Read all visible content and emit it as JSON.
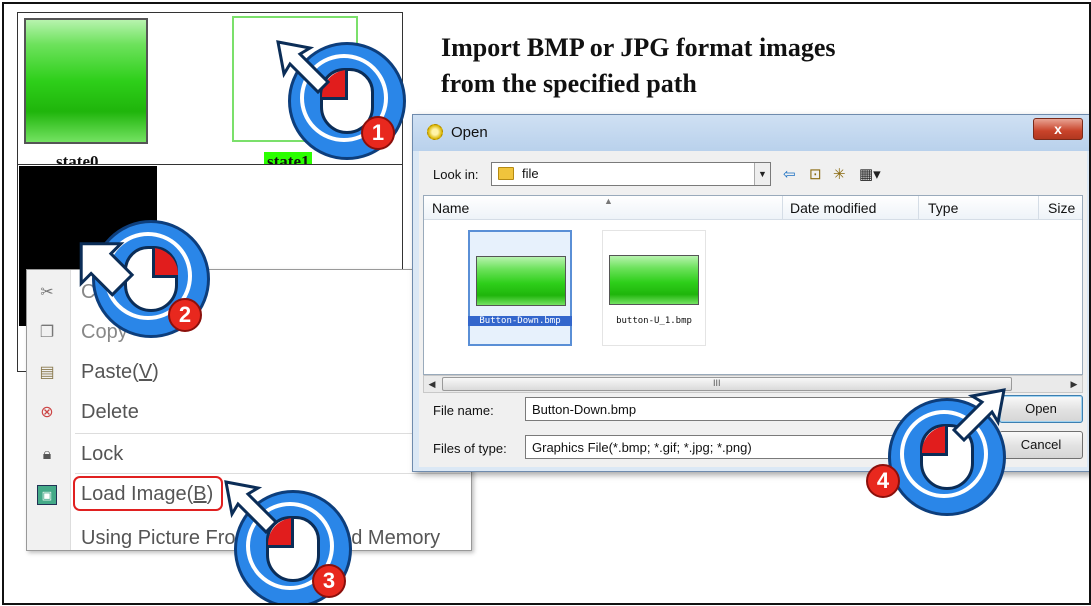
{
  "states": {
    "state0": "state0",
    "state1": "state1"
  },
  "context_menu": {
    "items": [
      {
        "label": "C",
        "icon": "scissors-icon"
      },
      {
        "label": "Copy",
        "icon": "copy-icon"
      },
      {
        "label": "Paste(V)",
        "label_main": "Paste(",
        "mnemonic": "V",
        "label_end": ")",
        "icon": "paste-icon"
      },
      {
        "label": "Delete",
        "icon": "delete-icon"
      },
      {
        "label": "Lock",
        "icon": "lock-icon"
      },
      {
        "label": "Load Image(B)",
        "label_main": "Load Image(",
        "mnemonic": "B",
        "label_end": ")",
        "icon": "load-image-icon"
      },
      {
        "label": "Using Picture Fro",
        "label_tail": "ded Memory",
        "icon": ""
      }
    ]
  },
  "heading": {
    "line1": "Import BMP or JPG format images",
    "line2": "from the specified path"
  },
  "dialog": {
    "title": "Open",
    "close_label": "x",
    "look_in_label": "Look in:",
    "look_in_value": "file",
    "toolbar_icons": [
      "back-arrow-icon",
      "up-folder-icon",
      "new-folder-icon",
      "view-menu-icon"
    ],
    "columns": [
      "Name",
      "Date modified",
      "Type",
      "Size"
    ],
    "files": [
      {
        "name": "Button-Down.bmp",
        "selected": true
      },
      {
        "name": "button-U_1.bmp",
        "selected": false
      }
    ],
    "file_name_label": "File name:",
    "file_name_value": "Button-Down.bmp",
    "files_of_type_label": "Files of type:",
    "files_of_type_value": "Graphics File(*.bmp; *.gif; *.jpg; *.png)",
    "open_button": "Open",
    "cancel_button": "Cancel",
    "scroll_grip": "III"
  },
  "steps": [
    "1",
    "2",
    "3",
    "4"
  ],
  "colors": {
    "accent_blue": "#2a86e8",
    "badge_red": "#e8281e",
    "button_green": "#2ecf1a",
    "state1_highlight": "#2bff00"
  }
}
